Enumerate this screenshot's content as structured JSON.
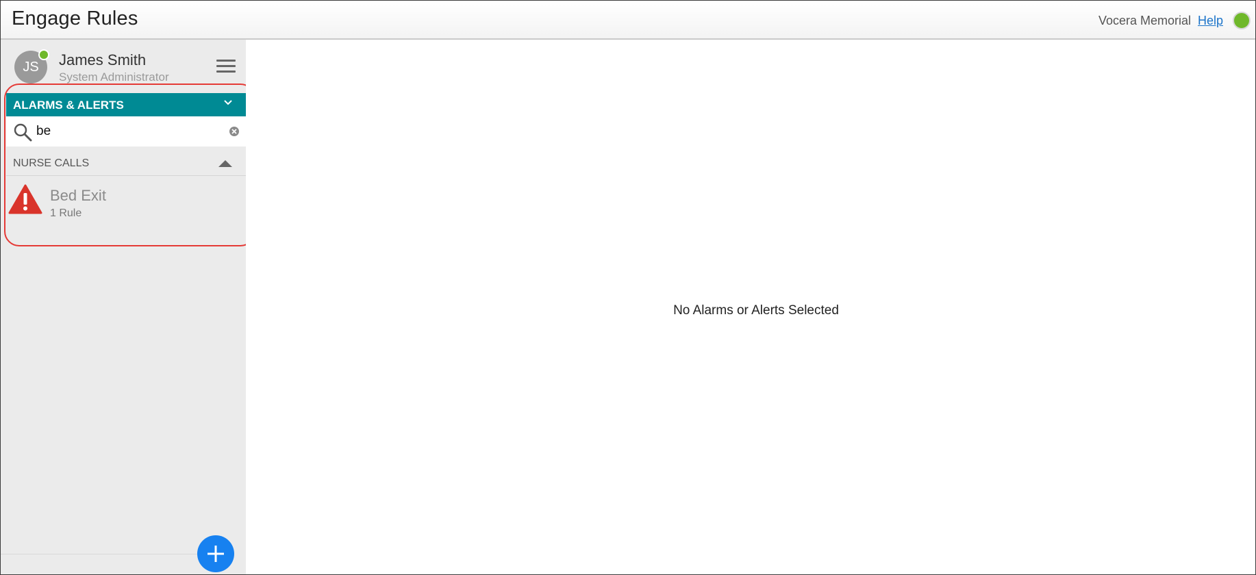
{
  "header": {
    "title": "Engage Rules",
    "org_name": "Vocera Memorial",
    "help_label": "Help",
    "status_color": "#6fb82a"
  },
  "user": {
    "initials": "JS",
    "name": "James Smith",
    "role": "System Administrator",
    "presence": "online"
  },
  "sidebar": {
    "menu_icon": "hamburger-menu-icon",
    "section_title": "ALARMS & ALERTS",
    "section_color": "#008a94",
    "search": {
      "value": "be",
      "placeholder": ""
    },
    "groups": [
      {
        "title": "NURSE CALLS",
        "expanded": true,
        "items": [
          {
            "title": "Bed Exit",
            "subtitle": "1 Rule",
            "icon": "warning-icon"
          }
        ]
      }
    ],
    "add_icon": "plus-icon",
    "add_color": "#1781f0"
  },
  "main": {
    "empty_message": "No Alarms or Alerts Selected"
  }
}
